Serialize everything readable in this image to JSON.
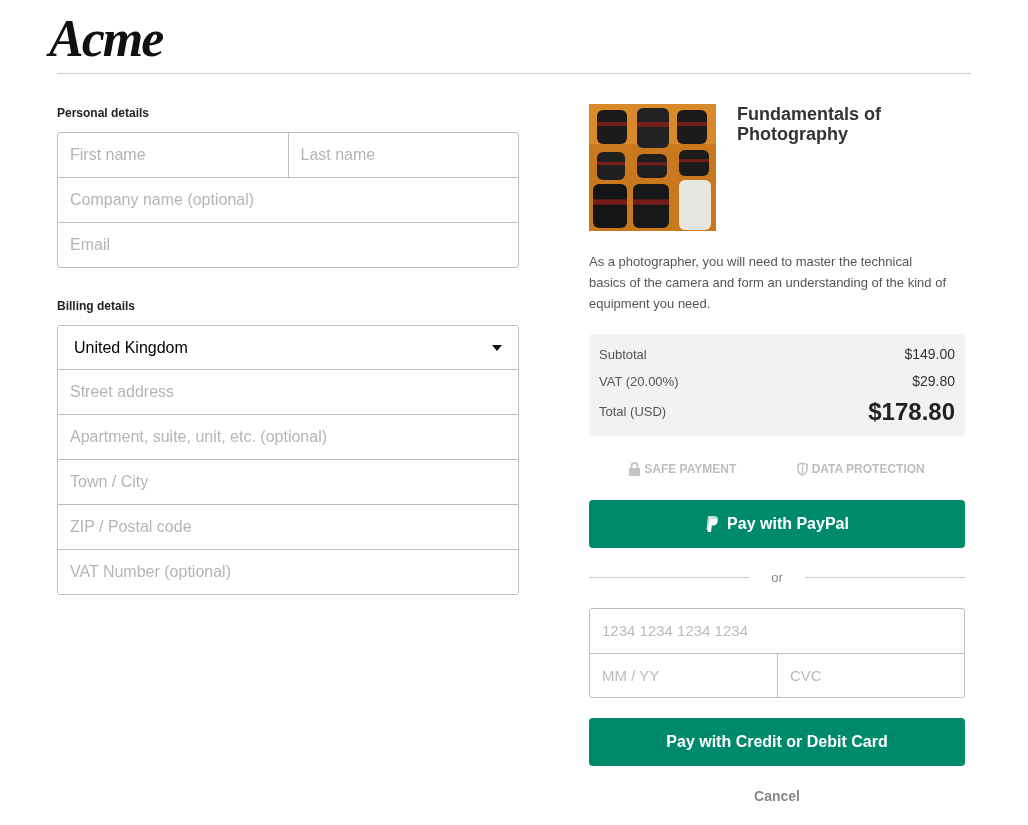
{
  "logo": {
    "text": "Acme"
  },
  "personal_details": {
    "title": "Personal details",
    "rows": [
      [
        {
          "placeholder": "First name"
        },
        {
          "placeholder": "Last name"
        }
      ],
      [
        {
          "placeholder": "Company name (optional)"
        }
      ],
      [
        {
          "placeholder": "Email"
        }
      ]
    ]
  },
  "billing_details": {
    "title": "Billing details",
    "country": "United Kingdom",
    "rows": [
      [
        {
          "placeholder": "Street address"
        }
      ],
      [
        {
          "placeholder": "Apartment, suite, unit, etc. (optional)"
        }
      ],
      [
        {
          "placeholder": "Town / City"
        }
      ],
      [
        {
          "placeholder": "ZIP / Postal code"
        }
      ],
      [
        {
          "placeholder": "VAT Number (optional)"
        }
      ]
    ]
  },
  "product": {
    "title": "Fundamentals of Photography",
    "description": "As a photographer, you will need to master the technical basics of the camera and form an understanding of the kind of equipment you need."
  },
  "summary": [
    {
      "kind": "line",
      "label": "Subtotal",
      "value": "$149.00"
    },
    {
      "kind": "line",
      "label": "VAT (20.00%)",
      "value": "$29.80"
    },
    {
      "kind": "total",
      "label": "Total (USD)",
      "value": "$178.80"
    }
  ],
  "badges": [
    {
      "kind": "lock",
      "label": "SAFE PAYMENT"
    },
    {
      "kind": "shield",
      "label": "DATA PROTECTION"
    }
  ],
  "paypal_button": "Pay with PayPal",
  "divider": "or",
  "card": {
    "number": {
      "placeholder": "1234 1234 1234 1234"
    },
    "expiry": {
      "placeholder": "MM / YY"
    },
    "cvc": {
      "placeholder": "CVC"
    }
  },
  "card_button": "Pay with Credit or Debit Card",
  "cancel": "Cancel"
}
